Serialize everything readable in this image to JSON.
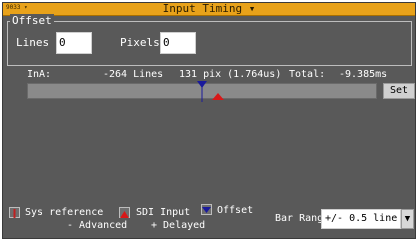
{
  "window": {
    "menu_label": "9033 ▾",
    "title": "Input Timing ▾"
  },
  "offset": {
    "legend": "Offset",
    "lines_label": "Lines",
    "lines_value": "0",
    "pixels_label": "Pixels",
    "pixels_value": "0"
  },
  "timing": {
    "input_label": "InA:",
    "lines": "-264 Lines",
    "pixels": "131 pix (1.764us)",
    "total_label": "Total:",
    "total_value": "-9.385ms"
  },
  "bar": {
    "set_label": "Set"
  },
  "legend": {
    "sys_reference": "Sys reference",
    "sdi_input": "SDI Input",
    "offset": "Offset",
    "advanced": "- Advanced",
    "delayed": "+ Delayed",
    "bar_range_label": "Bar Range",
    "bar_range_value": "+/- 0.5 line"
  },
  "colors": {
    "title_bar": "#e8a21a",
    "background": "#595959",
    "sys_reference_marker": "#c02020",
    "sdi_input_marker": "#d81818",
    "offset_marker": "#1a1a9c"
  }
}
